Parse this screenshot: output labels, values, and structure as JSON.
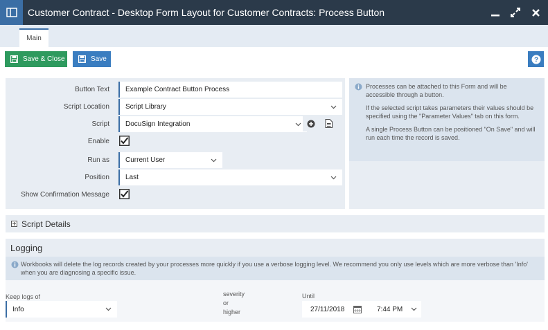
{
  "window": {
    "title": "Customer Contract - Desktop Form Layout for Customer Contracts: Process Button"
  },
  "tabs": [
    {
      "label": "Main"
    }
  ],
  "toolbar": {
    "save_close_label": "Save & Close",
    "save_label": "Save",
    "help_label": "?"
  },
  "form": {
    "button_text": {
      "label": "Button Text",
      "value": "Example Contract Button Process"
    },
    "script_location": {
      "label": "Script Location",
      "value": "Script Library"
    },
    "script": {
      "label": "Script",
      "value": "DocuSign Integration"
    },
    "enable": {
      "label": "Enable",
      "checked": true
    },
    "run_as": {
      "label": "Run as",
      "value": "Current User"
    },
    "position": {
      "label": "Position",
      "value": "Last"
    },
    "show_confirmation": {
      "label": "Show Confirmation Message",
      "checked": true
    }
  },
  "info": {
    "p1": "Processes can be attached to this Form and will be accessible through a button.",
    "p2": "If the selected script takes parameters their values should be specified using the \"Parameter Values\" tab on this form.",
    "p3": "A single Process Button can be positioned \"On Save\" and will run each time the record is saved."
  },
  "script_details": {
    "label": "Script Details"
  },
  "logging": {
    "title": "Logging",
    "info": "Workbooks will delete the log records created by your processes more quickly if you use a verbose logging level. We recommend you only use levels which are more verbose than 'Info' when you are diagnosing a specific issue.",
    "keep_logs_label": "Keep logs of",
    "keep_logs_value": "Info",
    "severity_1": "severity",
    "severity_2": "or",
    "severity_3": "higher",
    "until_label": "Until",
    "until_date": "27/11/2018",
    "until_time": "7:44 PM"
  },
  "colors": {
    "titlebar": "#2b3a4a",
    "accent": "#3b6ea5",
    "save_close": "#2e9a5e",
    "save": "#3a7dc0"
  }
}
